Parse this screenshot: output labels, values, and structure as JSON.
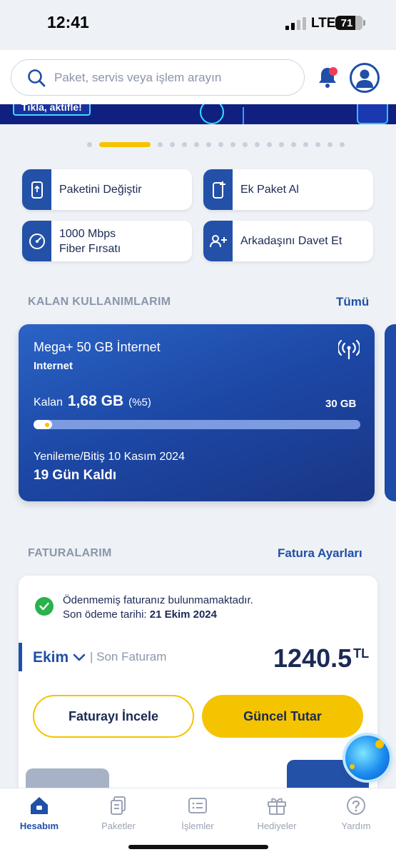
{
  "status_bar": {
    "time": "12:41",
    "network": "LTE",
    "battery": "71"
  },
  "search": {
    "placeholder": "Paket, servis veya işlem arayın"
  },
  "banner": {
    "text": "Tıkla, aktifle!"
  },
  "carousel": {
    "count": 18,
    "active_index": 1
  },
  "quick_actions": [
    {
      "label": "Paketini Değiştir",
      "icon": "phone-swap-icon"
    },
    {
      "label": "Ek Paket Al",
      "icon": "phone-add-icon"
    },
    {
      "label_line1": "1000 Mbps",
      "label_line2": "Fiber Fırsatı",
      "icon": "speedometer-icon"
    },
    {
      "label": "Arkadaşını Davet Et",
      "icon": "add-user-icon"
    }
  ],
  "usage": {
    "section_title": "KALAN KULLANIMLARIM",
    "all_link": "Tümü",
    "card": {
      "title": "Mega+ 50 GB İnternet",
      "subtitle": "Internet",
      "remaining_label": "Kalan",
      "remaining_amount": "1,68 GB",
      "remaining_percent": "(%5)",
      "total": "30 GB",
      "progress_fraction": 0.05,
      "renewal": "Yenileme/Bitiş 10 Kasım 2024",
      "days_left": "19 Gün Kaldı"
    }
  },
  "bills": {
    "section_title": "FATURALARIM",
    "settings_link": "Fatura Ayarları",
    "status_message": "Ödenmemiş faturanız bulunmamaktadır.",
    "due_label": "Son ödeme tarihi:",
    "due_date": "21 Ekim 2024",
    "month": "Ekim",
    "last_bill_label": "| Son Faturam",
    "amount": "1240.5",
    "currency": "TL",
    "review_button": "Faturayı İncele",
    "current_button": "Güncel Tutar"
  },
  "tabbar": [
    {
      "label": "Hesabım",
      "active": true
    },
    {
      "label": "Paketler",
      "active": false
    },
    {
      "label": "İşlemler",
      "active": false
    },
    {
      "label": "Hediyeler",
      "active": false
    },
    {
      "label": "Yardım",
      "active": false
    }
  ],
  "colors": {
    "primary": "#1f4fa6",
    "accent": "#f5c400",
    "success": "#2bb24c",
    "notification": "#ef3c5a"
  }
}
